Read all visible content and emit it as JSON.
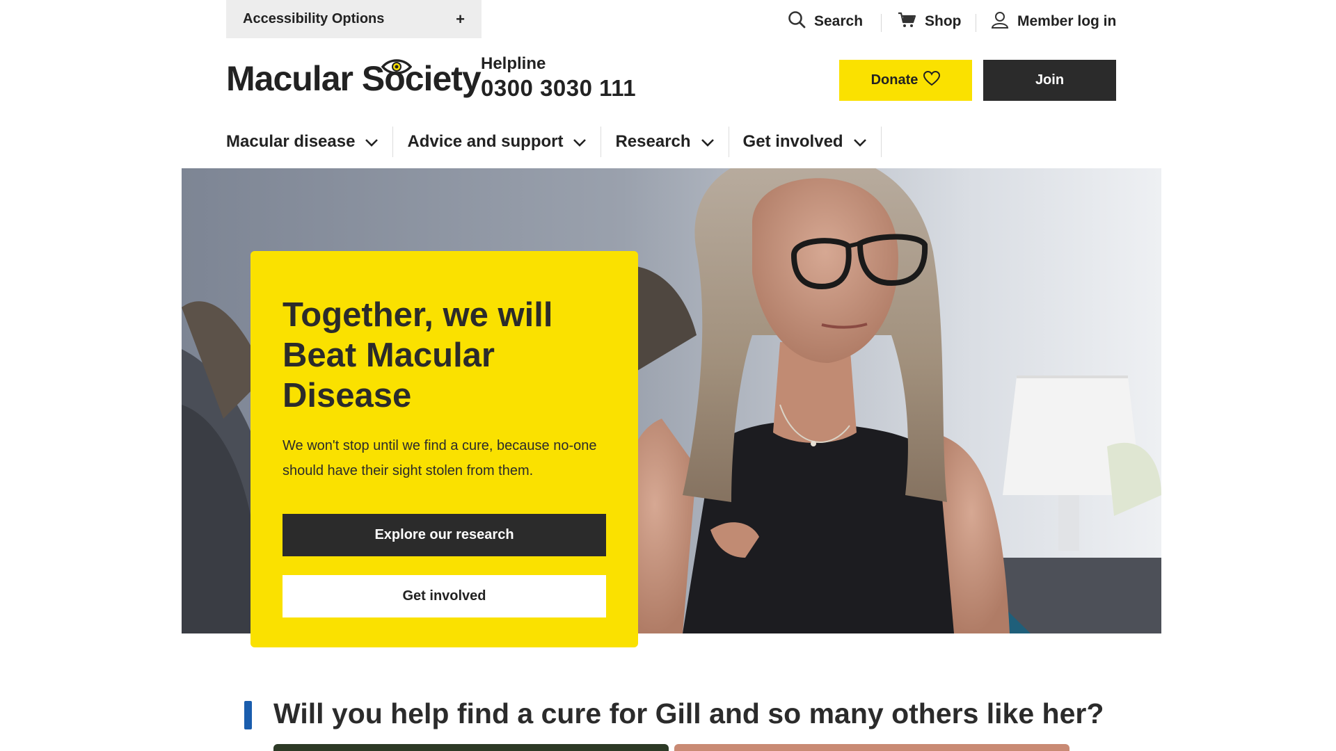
{
  "top_bar": {
    "accessibility_label": "Accessibility Options",
    "accessibility_toggle": "+",
    "search_label": "Search",
    "shop_label": "Shop",
    "member_label": "Member log in"
  },
  "header": {
    "logo_text": "Macular Society",
    "helpline_label": "Helpline",
    "helpline_number": "0300 3030 111",
    "donate_label": "Donate",
    "join_label": "Join"
  },
  "nav": {
    "items": [
      {
        "label": "Macular disease"
      },
      {
        "label": "Advice and support"
      },
      {
        "label": "Research"
      },
      {
        "label": "Get involved"
      }
    ]
  },
  "hero": {
    "title": "Together, we will Beat Macular Disease",
    "text": "We won't stop until we find a cure, because no-one should have their sight stolen from them.",
    "primary_button": "Explore our research",
    "secondary_button": "Get involved"
  },
  "section": {
    "title": "Will you help find a cure for Gill and so many others like her?"
  },
  "colors": {
    "brand_yellow": "#fae100",
    "dark": "#2b2b2b",
    "accent_blue": "#1a5dad"
  },
  "icons": {
    "search": "search-icon",
    "shop": "cart-icon",
    "member": "user-icon",
    "donate": "heart-icon",
    "nav_chevron": "chevron-down-icon",
    "logo_eye": "eye-icon"
  }
}
